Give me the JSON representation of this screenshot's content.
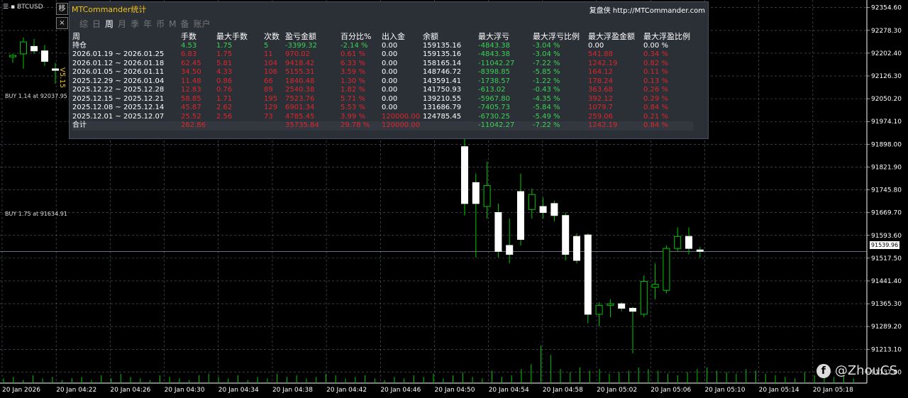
{
  "symbol": "BTCUSD",
  "side_tools": [
    "移",
    "×"
  ],
  "side_vertical_text": "V5.15",
  "panel": {
    "title": "MTCommander统计",
    "brand": "复盘侠 http://MTCommander.com",
    "tabs": [
      "综",
      "日",
      "周",
      "月",
      "季",
      "年",
      "币",
      "M",
      "备",
      "账户"
    ],
    "active_tab": "周",
    "headers": [
      "周",
      "手数",
      "最大手数",
      "次数",
      "盈亏金额",
      "百分比%",
      "出入金",
      "余额",
      "最大浮亏",
      "最大浮亏比例",
      "最大浮盈金额",
      "最大浮盈比例"
    ],
    "rows": [
      [
        "持仓",
        "4.53",
        "1.75",
        "5",
        "-3399.32",
        "-2.14 %",
        "0.00",
        "159135.16",
        "-4843.38",
        "-3.04 %",
        "0.00",
        "0.00 %"
      ],
      [
        "2026.01.19 ~ 2026.01.25",
        "6.83",
        "1.75",
        "11",
        "970.02",
        "0.61 %",
        "0.00",
        "159135.16",
        "-4843.38",
        "-3.04 %",
        "541.88",
        "0.34 %"
      ],
      [
        "2026.01.12 ~ 2026.01.18",
        "62.45",
        "5.81",
        "104",
        "9418.42",
        "6.33 %",
        "0.00",
        "158165.14",
        "-11042.27",
        "-7.22 %",
        "1242.19",
        "0.82 %"
      ],
      [
        "2026.01.05 ~ 2026.01.11",
        "34.50",
        "4.33",
        "106",
        "5155.31",
        "3.59 %",
        "0.00",
        "148746.72",
        "-8398.85",
        "-5.85 %",
        "164.12",
        "0.11 %"
      ],
      [
        "2025.12.29 ~ 2026.01.04",
        "11.48",
        "0.86",
        "66",
        "1840.48",
        "1.30 %",
        "0.00",
        "143591.41",
        "-1738.57",
        "-1.22 %",
        "178.24",
        "0.13 %"
      ],
      [
        "2025.12.22 ~ 2025.12.28",
        "12.83",
        "0.76",
        "89",
        "2540.38",
        "1.82 %",
        "0.00",
        "141750.93",
        "-613.02",
        "-0.43 %",
        "363.68",
        "0.26 %"
      ],
      [
        "2025.12.15 ~ 2025.12.21",
        "58.85",
        "1.71",
        "195",
        "7523.76",
        "5.71 %",
        "0.00",
        "139210.55",
        "-5967.80",
        "-4.35 %",
        "392.12",
        "0.29 %"
      ],
      [
        "2025.12.08 ~ 2025.12.14",
        "45.87",
        "2.62",
        "129",
        "6901.34",
        "5.53 %",
        "0.00",
        "131686.79",
        "-7405.73",
        "-5.84 %",
        "1079.7",
        "0.84 %"
      ],
      [
        "2025.12.01 ~ 2025.12.07",
        "25.52",
        "2.56",
        "73",
        "4785.45",
        "3.99 %",
        "120000.00",
        "124785.45",
        "-6730.25",
        "-5.49 %",
        "259.06",
        "0.21 %"
      ],
      [
        "合计",
        "262.86",
        "",
        "",
        "35735.84",
        "29.78 %",
        "120000.00",
        "",
        "-11042.27",
        "-7.22 %",
        "1242.19",
        "0.84 %"
      ]
    ]
  },
  "buy_labels": [
    "BUY 1.14 at 92037.95",
    "BUY 1.75 at 91634.91"
  ],
  "current_price": "91539.96",
  "watermark": "@ZhouCS",
  "watermark_icon": "facebook-icon",
  "colors": {
    "green": "#39d353",
    "red": "#e0262b",
    "grid": "#5a6070",
    "bull": "#ffffff",
    "wick": "#00c800"
  },
  "chart_data": {
    "type": "candlestick",
    "symbol": "BTCUSD",
    "y_ticks": [
      "92354.60",
      "92278.30",
      "92202.40",
      "92126.30",
      "92050.20",
      "91974.10",
      "91898.00",
      "91821.90",
      "91745.80",
      "91669.70",
      "91593.60",
      "91517.50",
      "91441.40",
      "91365.30",
      "91289.20",
      "91213.10",
      "91137.00"
    ],
    "x_ticks": [
      "20 Jan 2026",
      "20 Jan 04:22",
      "20 Jan 04:26",
      "20 Jan 04:30",
      "20 Jan 04:34",
      "20 Jan 04:38",
      "20 Jan 04:42",
      "20 Jan 04:46",
      "20 Jan 04:50",
      "20 Jan 04:54",
      "20 Jan 04:58",
      "20 Jan 05:02",
      "20 Jan 05:06",
      "20 Jan 05:10",
      "20 Jan 05:14",
      "20 Jan 05:18"
    ],
    "ylim": [
      91100,
      92380
    ],
    "candles": [
      {
        "o": 92190,
        "h": 92200,
        "l": 92170,
        "c": 92195
      },
      {
        "o": 92200,
        "h": 92255,
        "l": 92150,
        "c": 92240
      },
      {
        "o": 92225,
        "h": 92250,
        "l": 92200,
        "c": 92210
      },
      {
        "o": 92210,
        "h": 92230,
        "l": 92160,
        "c": 92175
      },
      {
        "o": 92150,
        "h": 92170,
        "l": 92100,
        "c": 92145
      },
      {
        "o": 91890,
        "h": 91920,
        "l": 91660,
        "c": 91700
      },
      {
        "o": 91770,
        "h": 91800,
        "l": 91520,
        "c": 91700
      },
      {
        "o": 91690,
        "h": 91840,
        "l": 91650,
        "c": 91760
      },
      {
        "o": 91670,
        "h": 91700,
        "l": 91520,
        "c": 91540
      },
      {
        "o": 91560,
        "h": 91650,
        "l": 91500,
        "c": 91530
      },
      {
        "o": 91740,
        "h": 91800,
        "l": 91560,
        "c": 91580
      },
      {
        "o": 91680,
        "h": 91750,
        "l": 91650,
        "c": 91730
      },
      {
        "o": 91690,
        "h": 91720,
        "l": 91650,
        "c": 91670
      },
      {
        "o": 91700,
        "h": 91710,
        "l": 91640,
        "c": 91660
      },
      {
        "o": 91660,
        "h": 91670,
        "l": 91510,
        "c": 91530
      },
      {
        "o": 91590,
        "h": 91600,
        "l": 91500,
        "c": 91510
      },
      {
        "o": 91595,
        "h": 91600,
        "l": 91300,
        "c": 91330
      },
      {
        "o": 91330,
        "h": 91370,
        "l": 91290,
        "c": 91360
      },
      {
        "o": 91360,
        "h": 91380,
        "l": 91320,
        "c": 91365
      },
      {
        "o": 91365,
        "h": 91370,
        "l": 91340,
        "c": 91350
      },
      {
        "o": 91350,
        "h": 91355,
        "l": 91200,
        "c": 91340
      },
      {
        "o": 91330,
        "h": 91460,
        "l": 91320,
        "c": 91440
      },
      {
        "o": 91420,
        "h": 91500,
        "l": 91380,
        "c": 91430
      },
      {
        "o": 91410,
        "h": 91560,
        "l": 91400,
        "c": 91550
      },
      {
        "o": 91550,
        "h": 91620,
        "l": 91540,
        "c": 91590
      },
      {
        "o": 91590,
        "h": 91620,
        "l": 91530,
        "c": 91550
      },
      {
        "o": 91545,
        "h": 91555,
        "l": 91520,
        "c": 91540
      }
    ],
    "volumes": [
      3,
      4,
      2,
      5,
      3,
      4,
      2,
      3,
      4,
      2,
      5,
      3,
      6,
      4,
      3,
      2,
      5,
      4,
      3,
      2,
      5,
      6,
      4,
      3,
      5,
      2,
      4,
      3,
      6,
      4,
      5,
      3,
      4,
      6,
      5,
      3,
      4,
      5,
      3,
      2,
      4,
      3,
      5,
      4,
      6,
      3,
      5,
      7,
      4,
      3,
      8,
      4,
      5,
      9,
      12,
      24,
      18,
      9,
      7,
      10,
      8,
      9,
      6,
      7,
      8,
      10,
      9,
      8,
      6,
      5,
      7,
      9,
      10,
      8,
      7,
      6,
      9,
      8,
      6,
      5,
      4,
      3,
      7,
      5,
      6,
      4,
      5,
      3
    ]
  }
}
